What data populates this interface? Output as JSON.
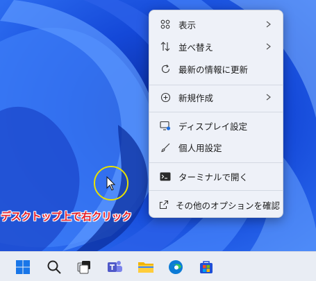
{
  "menu": {
    "items": [
      {
        "label": "表示",
        "icon": "grid-view-icon",
        "submenu": true
      },
      {
        "label": "並べ替え",
        "icon": "sort-arrows-icon",
        "submenu": true
      },
      {
        "label": "最新の情報に更新",
        "icon": "refresh-icon",
        "submenu": false
      },
      {
        "label": "新規作成",
        "icon": "plus-circle-icon",
        "submenu": true
      },
      {
        "label": "ディスプレイ設定",
        "icon": "display-settings-icon",
        "submenu": false
      },
      {
        "label": "個人用設定",
        "icon": "brush-icon",
        "submenu": false
      },
      {
        "label": "ターミナルで開く",
        "icon": "terminal-icon",
        "submenu": false
      },
      {
        "label": "その他のオプションを確認",
        "icon": "share-icon",
        "submenu": false
      }
    ]
  },
  "annotation": {
    "text": "デスクトップ上で右クリック",
    "color": "#e4202a"
  },
  "taskbar": {
    "icons": [
      "windows-start-icon",
      "search-icon",
      "task-view-icon",
      "teams-chat-icon",
      "file-explorer-icon",
      "edge-browser-icon",
      "microsoft-store-icon"
    ]
  },
  "colors": {
    "accent": "#1f4fd6",
    "highlight_ring": "#e8e200",
    "menu_bg": "#eef1f8"
  }
}
